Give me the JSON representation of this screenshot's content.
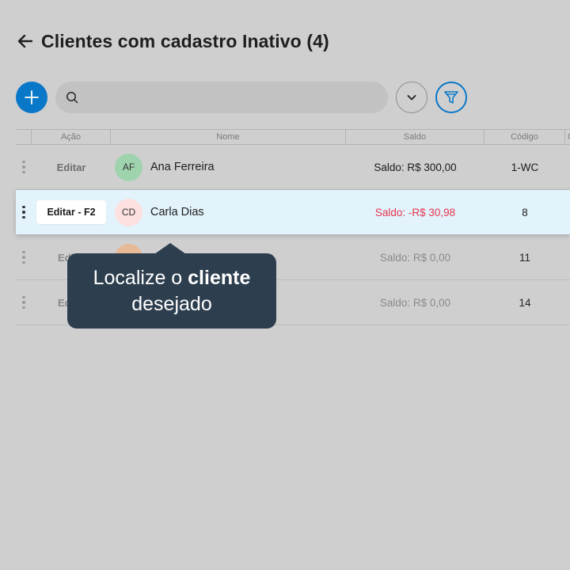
{
  "header": {
    "back_icon": "arrow-left-icon",
    "title": "Clientes com cadastro Inativo (4)"
  },
  "toolbar": {
    "add_icon": "plus-icon",
    "search_icon": "search-icon",
    "search_placeholder": "",
    "search_value": "",
    "expand_icon": "chevron-down-icon",
    "filter_icon": "filter-icon"
  },
  "table": {
    "columns": [
      "Ação",
      "Nome",
      "Saldo",
      "Código",
      "C"
    ],
    "rows": [
      {
        "action": "Editar",
        "initials": "AF",
        "name": "Ana Ferreira",
        "saldo": "Saldo: R$ 300,00",
        "codigo": "1-WC",
        "avatar_color": "#9fd3ad"
      },
      {
        "action": "Editar - F2",
        "initials": "CD",
        "name": "Carla Dias",
        "saldo": "Saldo: -R$ 30,98",
        "codigo": "8",
        "avatar_color": "#fde0e0"
      },
      {
        "action": "Edi",
        "initials": "",
        "name": "",
        "saldo": "Saldo: R$ 0,00",
        "codigo": "11",
        "avatar_color": "#e8b996"
      },
      {
        "action": "Ed",
        "initials": "",
        "name": "",
        "saldo": "Saldo: R$ 0,00",
        "codigo": "14",
        "avatar_color": "#c9c9c9"
      }
    ]
  },
  "tooltip": {
    "line1_prefix": "Localize o ",
    "line1_bold": "cliente",
    "line2": "desejado"
  },
  "colors": {
    "accent": "#0a78c9",
    "negative": "#e8344f",
    "highlight_row": "#e2f3fb",
    "tooltip_bg": "#2d3e4e",
    "overlay": "#cfcfcf"
  }
}
